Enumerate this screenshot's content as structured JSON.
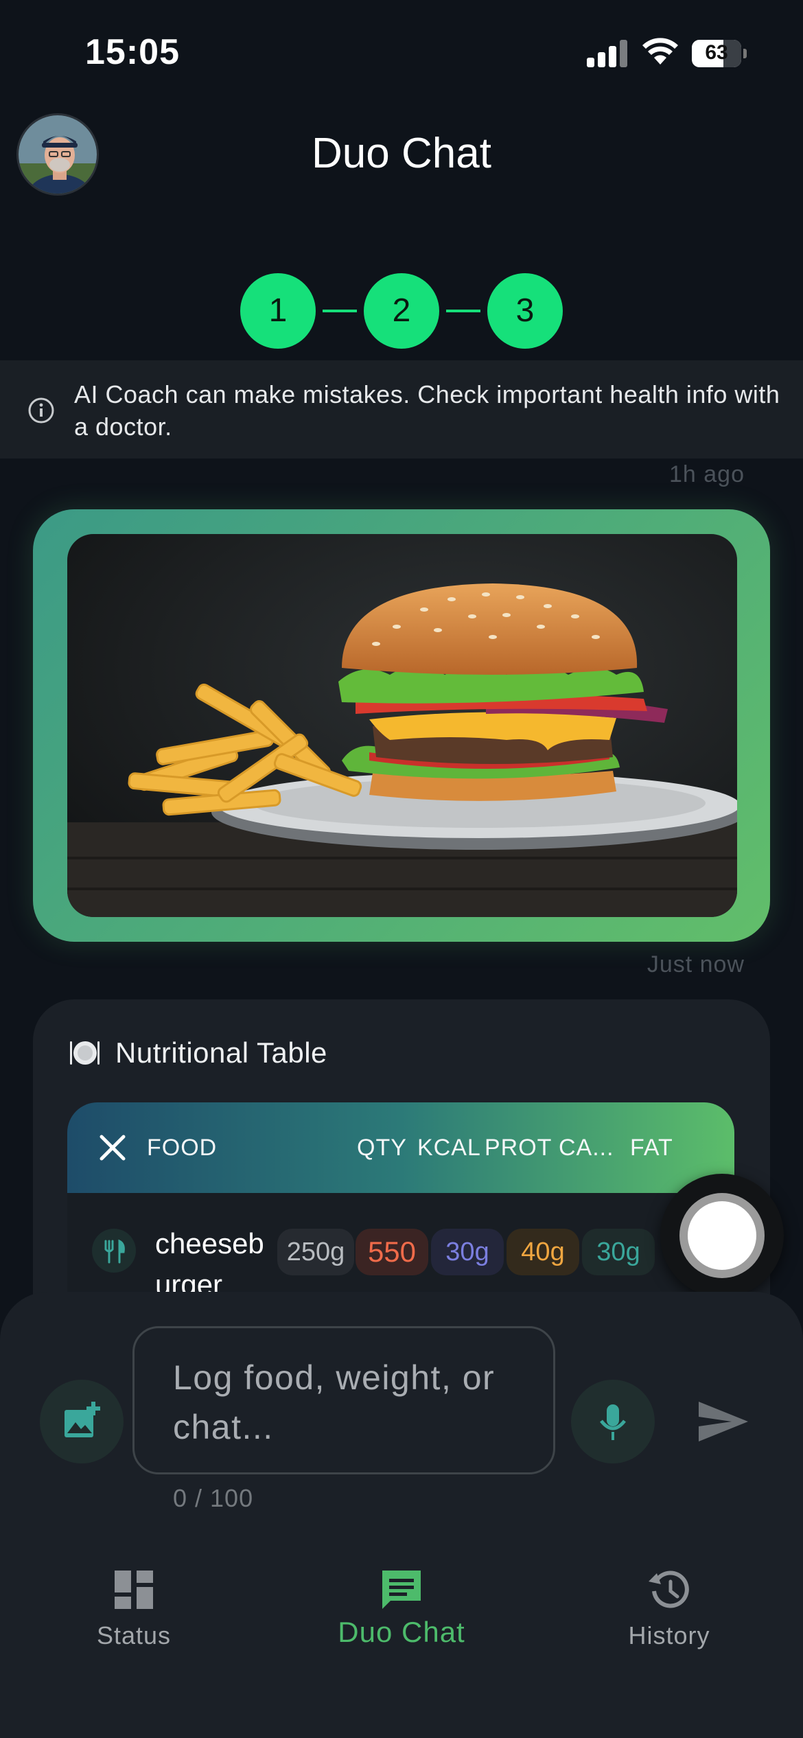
{
  "status_bar": {
    "time": "15:05",
    "battery": "63"
  },
  "header": {
    "title": "Duo Chat",
    "avatar_icon": "user-avatar"
  },
  "stepper": {
    "steps": [
      "1",
      "2",
      "3"
    ],
    "accent_color": "#16e07a"
  },
  "disclaimer": {
    "text": "AI Coach can make mistakes. Check important health info with a doctor."
  },
  "messages": {
    "image_timestamp": "1h ago",
    "table_timestamp": "Just now"
  },
  "nutrition_card": {
    "title": "Nutritional Table",
    "columns": [
      "FOOD",
      "QTY",
      "KCAL",
      "PROT",
      "CA...",
      "FAT"
    ],
    "rows": [
      {
        "food": "cheeseburger",
        "food_display_line1": "cheeseb",
        "food_display_line2": "urger",
        "qty": "250g",
        "kcal": "550",
        "prot": "30g",
        "carbs": "40g",
        "fat": "30g"
      }
    ]
  },
  "composer": {
    "placeholder": "Log food, weight, or chat...",
    "char_count": "0 / 100"
  },
  "bottom_nav": {
    "items": [
      {
        "label": "Status",
        "icon": "dashboard-icon",
        "active": false
      },
      {
        "label": "Duo Chat",
        "icon": "chat-icon",
        "active": true
      },
      {
        "label": "History",
        "icon": "history-icon",
        "active": false
      }
    ]
  },
  "colors": {
    "accent_green": "#4dbb6b",
    "background": "#0e131a",
    "card": "#1b2027",
    "kcal": "#f06b4a",
    "protein": "#7b7fe0",
    "carbs": "#f0a640",
    "fat": "#3aa79b"
  }
}
